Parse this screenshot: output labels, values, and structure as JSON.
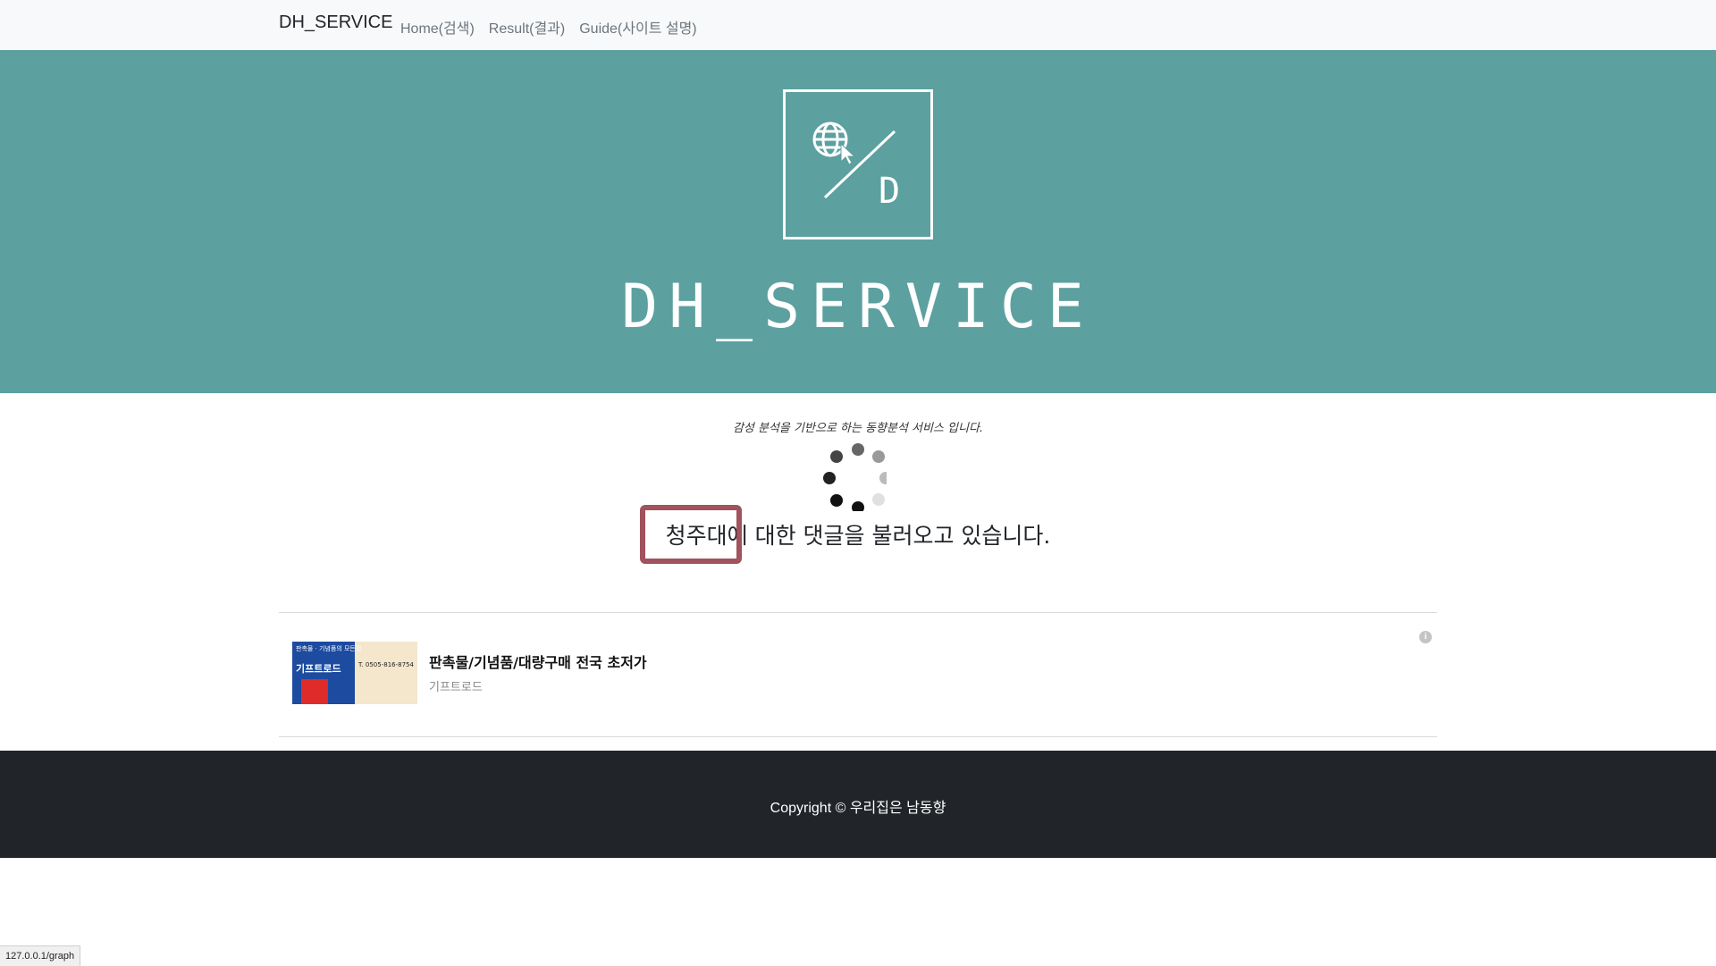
{
  "nav": {
    "brand": "DH_SERVICE",
    "links": [
      "Home(검색)",
      "Result(결과)",
      "Guide(사이트 설명)"
    ]
  },
  "hero": {
    "logo_letter": "D",
    "title": "DH_SERVICE"
  },
  "main": {
    "subtitle": "감성 분석을 기반으로 하는 동향분석 서비스 입니다.",
    "loading_message": "청주대에 대한 댓글을 불러오고 있습니다."
  },
  "ad": {
    "title": "판촉물/기념품/대량구매 전국 초저가",
    "source": "기프트로드",
    "thumb_top": "판촉물 · 기념품의 모든것",
    "thumb_brand": "기프트로드",
    "thumb_phone": "T. 0505-816-8754",
    "info_icon": "info-icon"
  },
  "footer": {
    "copyright": "Copyright © 우리집은 남동향"
  },
  "status": {
    "url": "127.0.0.1/graph"
  },
  "colors": {
    "hero_bg": "#5ca0a0",
    "footer_bg": "#212529",
    "highlight": "#a0535d"
  }
}
